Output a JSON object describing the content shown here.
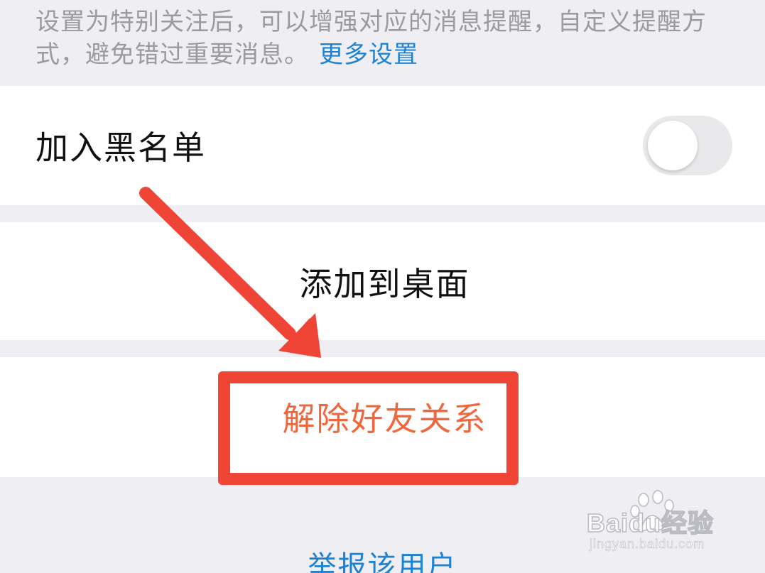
{
  "notice": {
    "text": "设置为特别关注后，可以增强对应的消息提醒，自定义提醒方式，避免错过重要消息。",
    "link_label": "更多设置"
  },
  "blacklist": {
    "label": "加入黑名单",
    "toggle_on": false
  },
  "add_to_desktop": {
    "label": "添加到桌面"
  },
  "unfriend": {
    "label": "解除好友关系"
  },
  "report": {
    "label": "举报该用户"
  },
  "annotation": {
    "arrow_color": "#ee4536",
    "box_color": "#ee4536"
  },
  "watermark": {
    "brand": "Baidu经验",
    "url": "jingyan.baidu.com"
  },
  "colors": {
    "link_blue": "#1e82d2",
    "destructive_orange": "#f0663d",
    "background_gray": "#eeeef3"
  }
}
